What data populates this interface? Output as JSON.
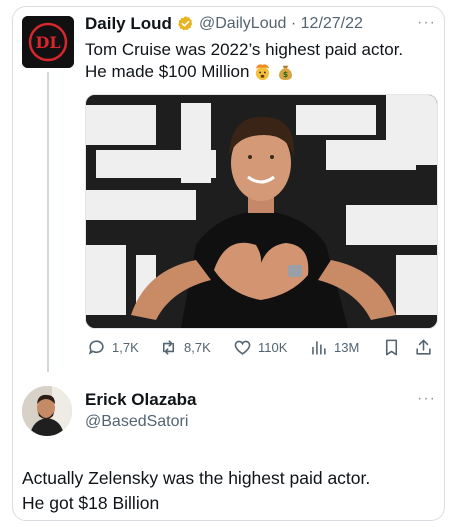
{
  "tweet": {
    "author_name": "Daily Loud",
    "author_handle": "@DailyLoud",
    "separator": "·",
    "date": "12/27/22",
    "line1": "Tom Cruise was 2022’s highest paid actor.",
    "line2": "He made $100 Million",
    "emojis": [
      "exploding-head-emoji",
      "money-bag-emoji"
    ],
    "more": "···"
  },
  "actions": {
    "replies": "1,7K",
    "retweets": "8,7K",
    "likes": "110K",
    "views": "13M"
  },
  "reply": {
    "author_name": "Erick Olazaba",
    "author_handle": "@BasedSatori",
    "more": "···",
    "line1": "Actually Zelensky was the highest paid actor.",
    "line2": "He got $18 Billion"
  },
  "colors": {
    "text": "#0f1419",
    "muted": "#536471",
    "border": "#d9dde1",
    "verified_gold": "#e8b422",
    "logo_red": "#d8262f"
  }
}
